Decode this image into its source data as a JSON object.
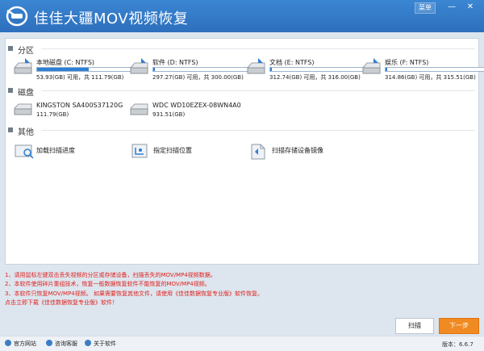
{
  "app": {
    "title": "佳佳大疆MOV视频恢复",
    "menu_label": "菜单",
    "minimize_symbol": "—",
    "close_symbol": "✕"
  },
  "sections": {
    "partitions": "分区",
    "disks": "磁盘",
    "other": "其他"
  },
  "partitions": [
    {
      "name": "本地磁盘 (C: NTFS)",
      "size": "53.93(GB) 可用，共 111.79(GB)",
      "used_fraction": 0.52
    },
    {
      "name": "软件 (D: NTFS)",
      "size": "297.27(GB) 可用，共 300.00(GB)",
      "used_fraction": 0.01
    },
    {
      "name": "文档 (E: NTFS)",
      "size": "312.74(GB) 可用，共 316.00(GB)",
      "used_fraction": 0.01
    },
    {
      "name": "娱乐 (F: NTFS)",
      "size": "314.86(GB) 可用，共 315.51(GB)",
      "used_fraction": 0.005
    }
  ],
  "disks": [
    {
      "name": "KINGSTON SA400S37120G",
      "size": "111.79(GB)"
    },
    {
      "name": "WDC WD10EZEX-08WN4A0",
      "size": "931.51(GB)"
    }
  ],
  "others": [
    {
      "label": "加载扫描进度"
    },
    {
      "label": "指定扫描位置"
    },
    {
      "label": "扫描存储设备镜像"
    }
  ],
  "notices": [
    "1、请用鼠标左键双击丢失视频的分区或存储设备，扫描丢失的MOV/MP4视频数据。",
    "2、本软件使用碎片重组技术，恢复一般数据恢复软件不能恢复的MOV/MP4视频。",
    "3、本软件只恢复MOV/MP4视频。 如果需要恢复其他文件，请使用《佳佳数据恢复专业版》软件恢复。",
    "   点击立即下载《佳佳数据恢复专业版》软件！"
  ],
  "buttons": {
    "scan": "扫描",
    "next": "下一步"
  },
  "footer": {
    "website": "官方网站",
    "support": "咨询客服",
    "about": "关于软件",
    "version": "版本：6.6.7"
  },
  "colors": {
    "titlebar": "#2d6fbd",
    "bar_fill": "#2e7fd6",
    "notice_text": "#e0201c",
    "primary_button": "#f08a22"
  }
}
